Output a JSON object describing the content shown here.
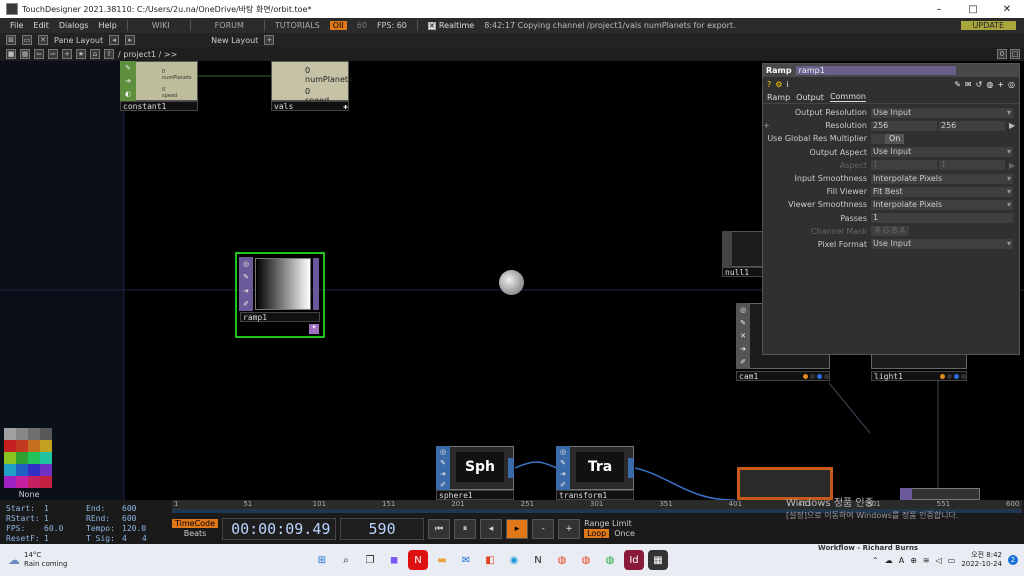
{
  "window": {
    "title": "TouchDesigner 2021.38110: C:/Users/2u.na/OneDrive/바탕 화면/orbit.toe*",
    "min": "–",
    "max": "□",
    "close": "✕"
  },
  "menu": {
    "items": [
      "File",
      "Edit",
      "Dialogs",
      "Help"
    ],
    "wiki": "WIKI",
    "forum": "FORUM",
    "tutorials": "TUTORIALS",
    "oii": "OII",
    "oii_num": "60",
    "fps_label": "FPS:",
    "fps_value": "60",
    "realtime_label": "Realtime",
    "status_msg": "8:42:17 Copying channel /project1/vals numPlanets for export.",
    "update": "UPDATE"
  },
  "panebar": {
    "pane_layout": "Pane Layout",
    "new_layout": "New Layout",
    "plus": "+"
  },
  "pathbar": {
    "path": "/ project1 / >>",
    "right0": "0",
    "right1": "□"
  },
  "nodes": {
    "constant1": {
      "label": "constant1",
      "text1": "0 numPlanets",
      "text2": "0 speed"
    },
    "vals": {
      "label": "vals",
      "text1": "0 numPlanets",
      "text2": "0 speed"
    },
    "ramp1": {
      "label": "ramp1"
    },
    "null": {
      "label": "null1"
    },
    "cam1": {
      "label": "cam1"
    },
    "light1": {
      "label": "light1"
    },
    "sphere1": {
      "label": "sphere1",
      "title": "Sph"
    },
    "transform1": {
      "label": "transform1",
      "title": "Tra"
    }
  },
  "param": {
    "op_type": "Ramp",
    "op_name": "ramp1",
    "tabs": [
      "Ramp",
      "Output",
      "Common"
    ],
    "rows": [
      {
        "label": "Output Resolution",
        "value": "Use Input",
        "menu": true
      },
      {
        "label": "Resolution",
        "v1": "256",
        "v2": "256"
      },
      {
        "label": "Use Global Res Multiplier",
        "toggle": "On"
      },
      {
        "label": "Output Aspect",
        "value": "Use Input",
        "menu": true
      },
      {
        "label": "Aspect",
        "v1": "1",
        "v2": "1",
        "dim": true
      },
      {
        "label": "Input Smoothness",
        "value": "Interpolate Pixels",
        "menu": true
      },
      {
        "label": "Fill Viewer",
        "value": "Fit Best",
        "menu": true
      },
      {
        "label": "Viewer Smoothness",
        "value": "Interpolate Pixels",
        "menu": true
      },
      {
        "label": "Passes",
        "value": "1"
      },
      {
        "label": "Channel Mask",
        "value": "R G B A",
        "dim": true
      },
      {
        "label": "Pixel Format",
        "value": "Use Input",
        "menu": true
      }
    ]
  },
  "palette": {
    "none_label": "None",
    "colors": [
      "#a0a0a0",
      "#888888",
      "#707070",
      "#585858",
      "#c42020",
      "#c43a20",
      "#c47020",
      "#c4a020",
      "#8ac420",
      "#30a030",
      "#20c45a",
      "#20c4a0",
      "#20a0c4",
      "#2060c4",
      "#3030c4",
      "#7030c4",
      "#a020c4",
      "#c420a0",
      "#c42060",
      "#c42040"
    ]
  },
  "stats": {
    "start_label": "Start:",
    "start": "1",
    "end_label": "End:",
    "end": "600",
    "rstart_label": "RStart:",
    "rstart": "1",
    "rend_label": "REnd:",
    "rend": "600",
    "fps_label": "FPS:",
    "fps": "60.0",
    "tempo_label": "Tempo:",
    "tempo": "120.0",
    "resetf_label": "ResetF:",
    "resetf": "1",
    "tsig_label": "T Sig:",
    "tsig1": "4",
    "tsig2": "4"
  },
  "timeline": {
    "ticks": [
      "1",
      "51",
      "101",
      "151",
      "201",
      "251",
      "301",
      "351",
      "401",
      "451",
      "501",
      "551",
      "600"
    ]
  },
  "transport": {
    "timecode": "TimeCode",
    "beats": "Beats",
    "time": "00:00:09.49",
    "frame": "590",
    "range_limit": "Range Limit",
    "loop": "Loop",
    "once": "Once",
    "minus": "-",
    "plus": "+"
  },
  "watermark": {
    "line1": "Windows 정품 인증",
    "line2": "[설정]으로 이동하여 Windows를 정품 인증합니다."
  },
  "taskbar": {
    "temp": "14°C",
    "weather": "Rain coming",
    "time": "오전 8:42",
    "date": "2022-10-24",
    "ime": "A",
    "notif": "2",
    "partial": "Workflow - Richard Burns"
  }
}
